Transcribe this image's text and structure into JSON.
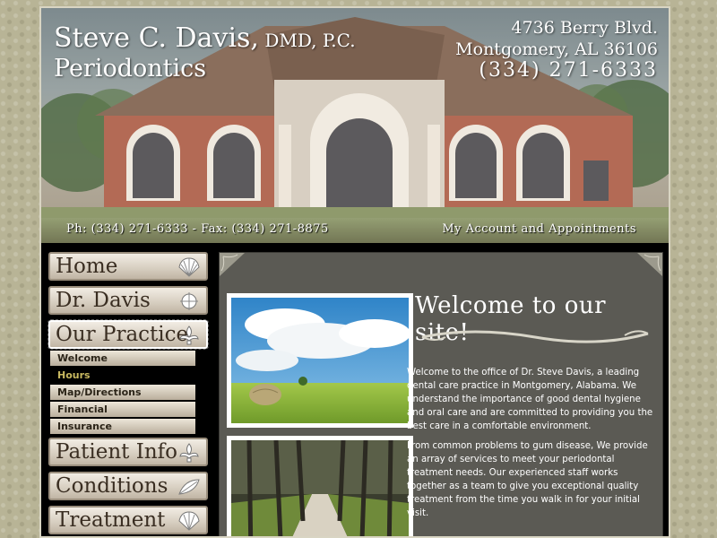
{
  "header": {
    "practice_name": "Steve C. Davis,",
    "credentials": " DMD, P.C.",
    "specialty": "Periodontics",
    "address_line1": "4736 Berry Blvd.",
    "address_line2": "Montgomery, AL 36106",
    "phone_large": "(334) 271-6333",
    "phone_fax": "Ph: (334) 271-6333 - Fax: (334) 271-8875",
    "account_link": "My Account and Appointments"
  },
  "nav": {
    "home": "Home",
    "dr_davis": "Dr. Davis",
    "our_practice": "Our Practice",
    "practice_sub": [
      "Welcome",
      "Hours",
      "Map/Directions",
      "Financial",
      "Insurance"
    ],
    "patient_info": "Patient Info",
    "conditions": "Conditions",
    "treatment": "Treatment"
  },
  "main": {
    "heading": "Welcome to our site!",
    "para1": "Welcome to the office of Dr. Steve Davis, a leading dental care practice in Montgomery, Alabama. We understand the importance of good dental hygiene and oral care and are committed to providing you the best care in a comfortable environment.",
    "para2": "From common problems to gum disease, We provide an array of services to meet your periodontal treatment needs.  Our experienced staff works together as a team to give you exceptional quality treatment from the time you walk in for your initial visit."
  },
  "colors": {
    "page_bg": "#b8b496",
    "content_bg": "#5b5a54",
    "sub_highlight": "#c8b860"
  }
}
